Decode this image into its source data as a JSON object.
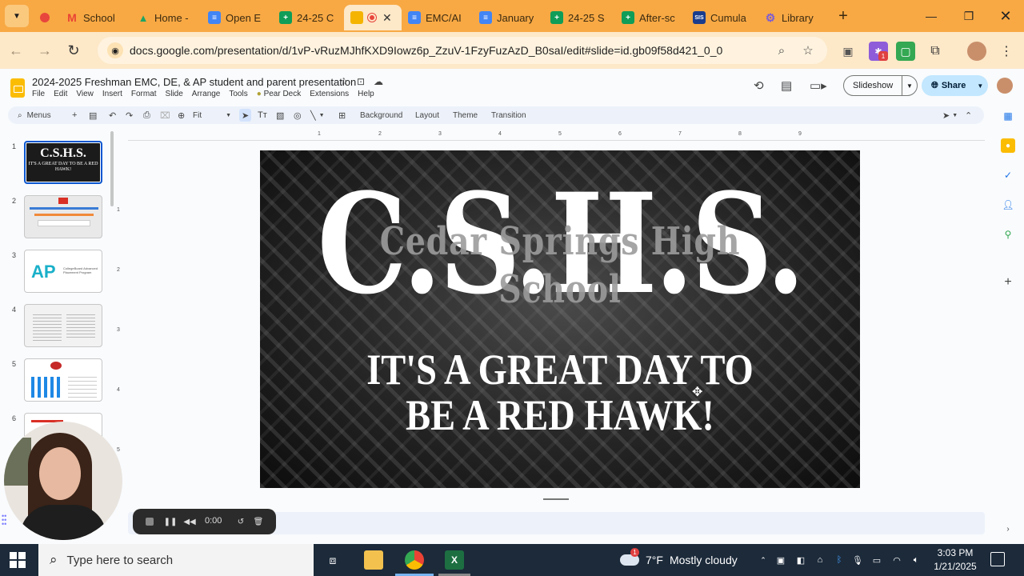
{
  "browser": {
    "tabs": [
      {
        "label": "",
        "icon": "recording-icon",
        "color": "#e8453c"
      },
      {
        "label": "School",
        "icon": "gmail-icon",
        "color": "#ea4335"
      },
      {
        "label": "Home -",
        "icon": "drive-icon",
        "color": "#1fa463"
      },
      {
        "label": "Open E",
        "icon": "docs-icon",
        "color": "#4285f4"
      },
      {
        "label": "24-25 C",
        "icon": "sheets-icon",
        "color": "#0f9d58"
      },
      {
        "label": "",
        "icon": "slides-icon",
        "color": "#f4b400",
        "active": true
      },
      {
        "label": "EMC/AI",
        "icon": "docs-icon",
        "color": "#4285f4"
      },
      {
        "label": "January",
        "icon": "docs-icon",
        "color": "#4285f4"
      },
      {
        "label": "24-25 S",
        "icon": "sheets-icon",
        "color": "#0f9d58"
      },
      {
        "label": "After-sc",
        "icon": "sheets-icon",
        "color": "#0f9d58"
      },
      {
        "label": "Cumula",
        "icon": "sis-icon",
        "color": "#1a3c8c"
      },
      {
        "label": "Library",
        "icon": "gear-icon",
        "color": "#7b5cd6"
      }
    ],
    "tab_sis_text": "SIS",
    "url": "docs.google.com/presentation/d/1vP-vRuzMJhfKXD9Iowz6p_ZzuV-1FzyFuzAzD_B0saI/edit#slide=id.gb09f58d421_0_0",
    "ext_badge": "1"
  },
  "slides_app": {
    "title": "2024-2025 Freshman EMC, DE, & AP student and parent presentation",
    "menus": [
      "File",
      "Edit",
      "View",
      "Insert",
      "Format",
      "Slide",
      "Arrange",
      "Tools",
      "Pear Deck",
      "Extensions",
      "Help"
    ],
    "slideshow_label": "Slideshow",
    "share_label": "Share",
    "toolbar": {
      "search_menus": "Menus",
      "zoom": "Fit",
      "background": "Background",
      "layout": "Layout",
      "theme": "Theme",
      "transition": "Transition"
    },
    "ruler_ticks": [
      "1",
      "2",
      "3",
      "4",
      "5",
      "6",
      "7",
      "8",
      "9"
    ],
    "vruler_ticks": [
      "1",
      "2",
      "3",
      "4",
      "5"
    ],
    "slide_numbers": [
      "1",
      "2",
      "3",
      "4",
      "5",
      "6"
    ],
    "thumb1_big": "C.S.H.S.",
    "thumb1_small": "IT'S A GREAT DAY TO BE A RED HAWK!",
    "thumb3_logo": "AP",
    "thumb3_small": "CollegeBoard Advanced Placement Program",
    "slide": {
      "big_text": "C.S.H.S.",
      "middle_text": "Cedar Springs High School",
      "line1": "IT'S A GREAT DAY TO",
      "line2": "BE A RED HAWK!"
    }
  },
  "recorder": {
    "time": "0:00"
  },
  "taskbar": {
    "search_placeholder": "Type here to search",
    "weather_temp": "7°F",
    "weather_desc": "Mostly cloudy",
    "weather_badge": "1",
    "time": "3:03 PM",
    "date": "1/21/2025"
  }
}
